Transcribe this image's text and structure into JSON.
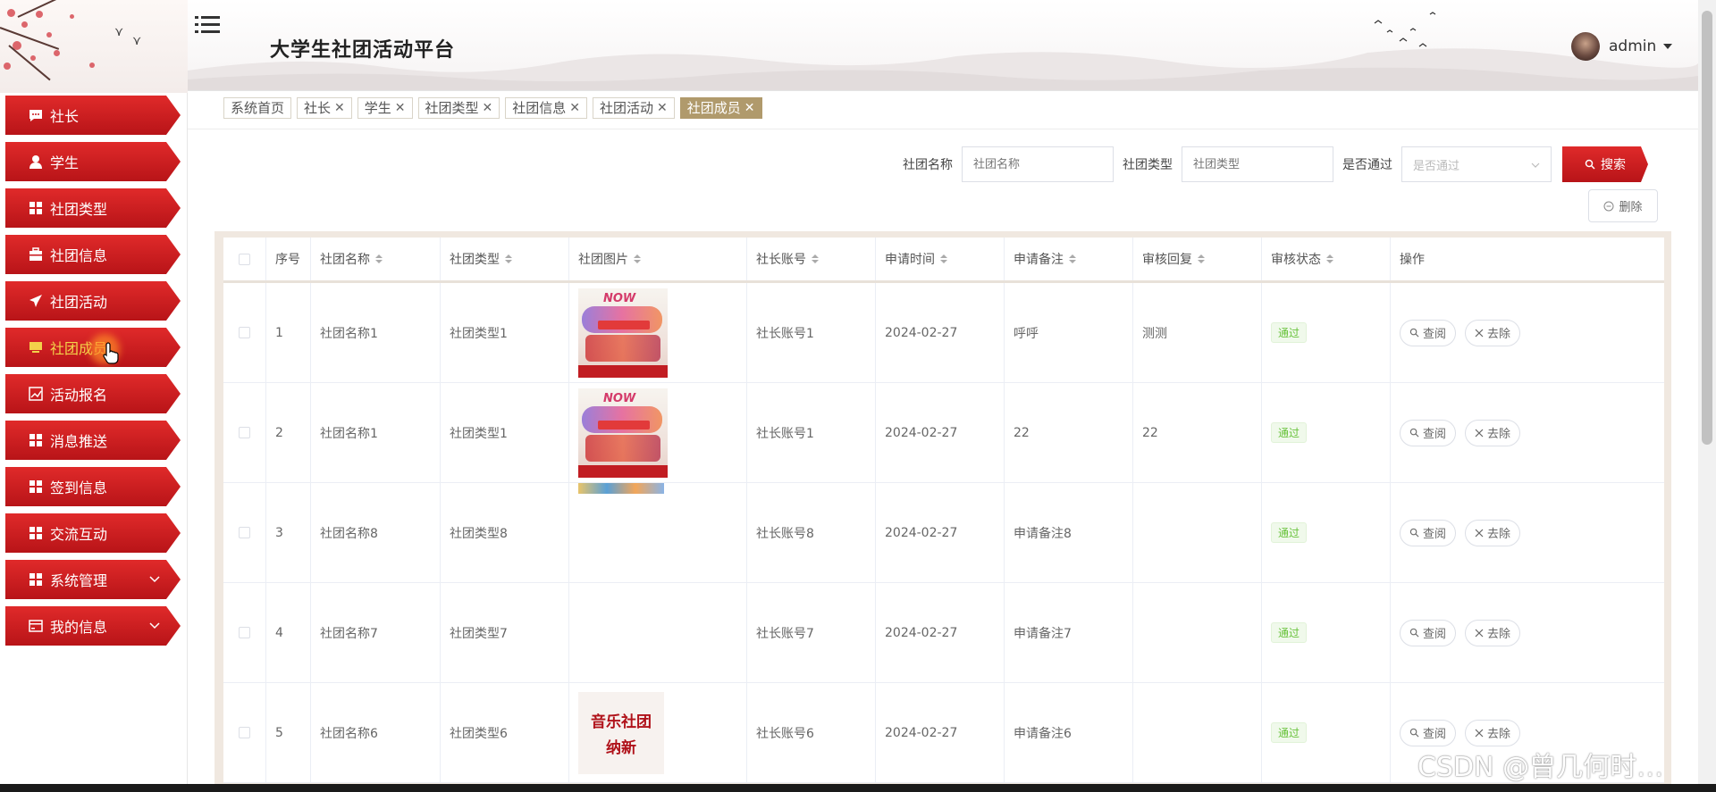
{
  "header": {
    "title": "大学生社团活动平台",
    "username": "admin"
  },
  "sidebar": {
    "items": [
      {
        "label": "社长",
        "icon": "chat-icon"
      },
      {
        "label": "学生",
        "icon": "user-icon"
      },
      {
        "label": "社团类型",
        "icon": "grid-icon"
      },
      {
        "label": "社团信息",
        "icon": "briefcase-icon"
      },
      {
        "label": "社团活动",
        "icon": "paper-plane-icon"
      },
      {
        "label": "社团成员",
        "icon": "monitor-icon",
        "active": true
      },
      {
        "label": "活动报名",
        "icon": "chart-icon"
      },
      {
        "label": "消息推送",
        "icon": "grid-icon"
      },
      {
        "label": "签到信息",
        "icon": "grid-icon"
      },
      {
        "label": "交流互动",
        "icon": "grid-icon"
      },
      {
        "label": "系统管理",
        "icon": "grid-icon",
        "expandable": true
      },
      {
        "label": "我的信息",
        "icon": "card-icon",
        "expandable": true
      }
    ]
  },
  "tags": [
    {
      "label": "系统首页",
      "closable": false
    },
    {
      "label": "社长",
      "closable": true
    },
    {
      "label": "学生",
      "closable": true
    },
    {
      "label": "社团类型",
      "closable": true
    },
    {
      "label": "社团信息",
      "closable": true
    },
    {
      "label": "社团活动",
      "closable": true
    },
    {
      "label": "社团成员",
      "closable": true,
      "active": true
    }
  ],
  "search": {
    "club_name_label": "社团名称",
    "club_name_placeholder": "社团名称",
    "club_type_label": "社团类型",
    "club_type_placeholder": "社团类型",
    "passed_label": "是否通过",
    "passed_placeholder": "是否通过",
    "search_button": "搜索",
    "delete_button": "删除"
  },
  "table": {
    "columns": [
      "序号",
      "社团名称",
      "社团类型",
      "社团图片",
      "社长账号",
      "申请时间",
      "申请备注",
      "审核回复",
      "审核状态",
      "操作"
    ],
    "rows": [
      {
        "index": "1",
        "name": "社团名称1",
        "type": "社团类型1",
        "image": "poster",
        "account": "社长账号1",
        "time": "2024-02-27",
        "note": "呼呼",
        "reply": "测测",
        "status": "通过"
      },
      {
        "index": "2",
        "name": "社团名称1",
        "type": "社团类型1",
        "image": "poster",
        "account": "社长账号1",
        "time": "2024-02-27",
        "note": "22",
        "reply": "22",
        "status": "通过"
      },
      {
        "index": "3",
        "name": "社团名称8",
        "type": "社团类型8",
        "image": "strip",
        "account": "社长账号8",
        "time": "2024-02-27",
        "note": "申请备注8",
        "reply": "",
        "status": "通过"
      },
      {
        "index": "4",
        "name": "社团名称7",
        "type": "社团类型7",
        "image": "none",
        "account": "社长账号7",
        "time": "2024-02-27",
        "note": "申请备注7",
        "reply": "",
        "status": "通过"
      },
      {
        "index": "5",
        "name": "社团名称6",
        "type": "社团类型6",
        "image": "music",
        "account": "社长账号6",
        "time": "2024-02-27",
        "note": "申请备注6",
        "reply": "",
        "status": "通过"
      }
    ],
    "view_button": "查阅",
    "remove_button": "去除"
  },
  "images": {
    "poster_top": "NOW",
    "music_line1": "音乐社团",
    "music_line2": "纳新"
  },
  "watermark": "CSDN @曾几何时…",
  "colors": {
    "menu_red": "#d21d22",
    "active_tag": "#b09a6c",
    "status_green": "#67c23a",
    "active_menu_text": "#f3d24a"
  }
}
